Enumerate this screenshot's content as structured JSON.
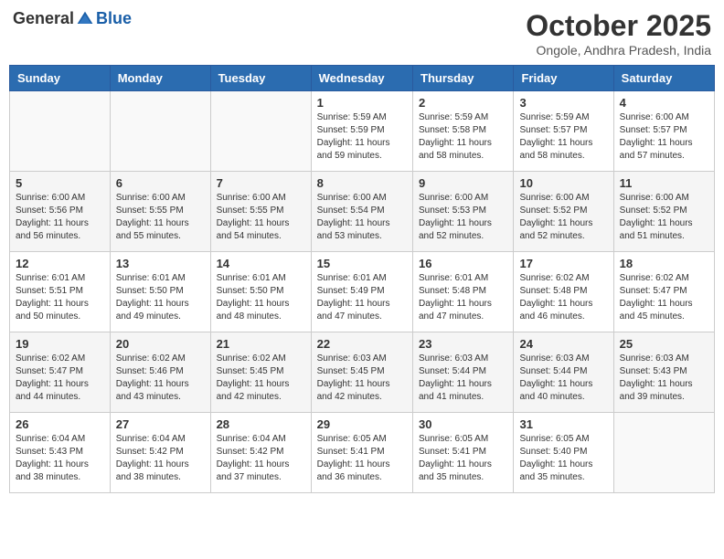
{
  "header": {
    "logo": {
      "general": "General",
      "blue": "Blue"
    },
    "title": "October 2025",
    "location": "Ongole, Andhra Pradesh, India"
  },
  "weekdays": [
    "Sunday",
    "Monday",
    "Tuesday",
    "Wednesday",
    "Thursday",
    "Friday",
    "Saturday"
  ],
  "weeks": [
    [
      {
        "day": "",
        "info": ""
      },
      {
        "day": "",
        "info": ""
      },
      {
        "day": "",
        "info": ""
      },
      {
        "day": "1",
        "info": "Sunrise: 5:59 AM\nSunset: 5:59 PM\nDaylight: 11 hours\nand 59 minutes."
      },
      {
        "day": "2",
        "info": "Sunrise: 5:59 AM\nSunset: 5:58 PM\nDaylight: 11 hours\nand 58 minutes."
      },
      {
        "day": "3",
        "info": "Sunrise: 5:59 AM\nSunset: 5:57 PM\nDaylight: 11 hours\nand 58 minutes."
      },
      {
        "day": "4",
        "info": "Sunrise: 6:00 AM\nSunset: 5:57 PM\nDaylight: 11 hours\nand 57 minutes."
      }
    ],
    [
      {
        "day": "5",
        "info": "Sunrise: 6:00 AM\nSunset: 5:56 PM\nDaylight: 11 hours\nand 56 minutes."
      },
      {
        "day": "6",
        "info": "Sunrise: 6:00 AM\nSunset: 5:55 PM\nDaylight: 11 hours\nand 55 minutes."
      },
      {
        "day": "7",
        "info": "Sunrise: 6:00 AM\nSunset: 5:55 PM\nDaylight: 11 hours\nand 54 minutes."
      },
      {
        "day": "8",
        "info": "Sunrise: 6:00 AM\nSunset: 5:54 PM\nDaylight: 11 hours\nand 53 minutes."
      },
      {
        "day": "9",
        "info": "Sunrise: 6:00 AM\nSunset: 5:53 PM\nDaylight: 11 hours\nand 52 minutes."
      },
      {
        "day": "10",
        "info": "Sunrise: 6:00 AM\nSunset: 5:52 PM\nDaylight: 11 hours\nand 52 minutes."
      },
      {
        "day": "11",
        "info": "Sunrise: 6:00 AM\nSunset: 5:52 PM\nDaylight: 11 hours\nand 51 minutes."
      }
    ],
    [
      {
        "day": "12",
        "info": "Sunrise: 6:01 AM\nSunset: 5:51 PM\nDaylight: 11 hours\nand 50 minutes."
      },
      {
        "day": "13",
        "info": "Sunrise: 6:01 AM\nSunset: 5:50 PM\nDaylight: 11 hours\nand 49 minutes."
      },
      {
        "day": "14",
        "info": "Sunrise: 6:01 AM\nSunset: 5:50 PM\nDaylight: 11 hours\nand 48 minutes."
      },
      {
        "day": "15",
        "info": "Sunrise: 6:01 AM\nSunset: 5:49 PM\nDaylight: 11 hours\nand 47 minutes."
      },
      {
        "day": "16",
        "info": "Sunrise: 6:01 AM\nSunset: 5:48 PM\nDaylight: 11 hours\nand 47 minutes."
      },
      {
        "day": "17",
        "info": "Sunrise: 6:02 AM\nSunset: 5:48 PM\nDaylight: 11 hours\nand 46 minutes."
      },
      {
        "day": "18",
        "info": "Sunrise: 6:02 AM\nSunset: 5:47 PM\nDaylight: 11 hours\nand 45 minutes."
      }
    ],
    [
      {
        "day": "19",
        "info": "Sunrise: 6:02 AM\nSunset: 5:47 PM\nDaylight: 11 hours\nand 44 minutes."
      },
      {
        "day": "20",
        "info": "Sunrise: 6:02 AM\nSunset: 5:46 PM\nDaylight: 11 hours\nand 43 minutes."
      },
      {
        "day": "21",
        "info": "Sunrise: 6:02 AM\nSunset: 5:45 PM\nDaylight: 11 hours\nand 42 minutes."
      },
      {
        "day": "22",
        "info": "Sunrise: 6:03 AM\nSunset: 5:45 PM\nDaylight: 11 hours\nand 42 minutes."
      },
      {
        "day": "23",
        "info": "Sunrise: 6:03 AM\nSunset: 5:44 PM\nDaylight: 11 hours\nand 41 minutes."
      },
      {
        "day": "24",
        "info": "Sunrise: 6:03 AM\nSunset: 5:44 PM\nDaylight: 11 hours\nand 40 minutes."
      },
      {
        "day": "25",
        "info": "Sunrise: 6:03 AM\nSunset: 5:43 PM\nDaylight: 11 hours\nand 39 minutes."
      }
    ],
    [
      {
        "day": "26",
        "info": "Sunrise: 6:04 AM\nSunset: 5:43 PM\nDaylight: 11 hours\nand 38 minutes."
      },
      {
        "day": "27",
        "info": "Sunrise: 6:04 AM\nSunset: 5:42 PM\nDaylight: 11 hours\nand 38 minutes."
      },
      {
        "day": "28",
        "info": "Sunrise: 6:04 AM\nSunset: 5:42 PM\nDaylight: 11 hours\nand 37 minutes."
      },
      {
        "day": "29",
        "info": "Sunrise: 6:05 AM\nSunset: 5:41 PM\nDaylight: 11 hours\nand 36 minutes."
      },
      {
        "day": "30",
        "info": "Sunrise: 6:05 AM\nSunset: 5:41 PM\nDaylight: 11 hours\nand 35 minutes."
      },
      {
        "day": "31",
        "info": "Sunrise: 6:05 AM\nSunset: 5:40 PM\nDaylight: 11 hours\nand 35 minutes."
      },
      {
        "day": "",
        "info": ""
      }
    ]
  ]
}
